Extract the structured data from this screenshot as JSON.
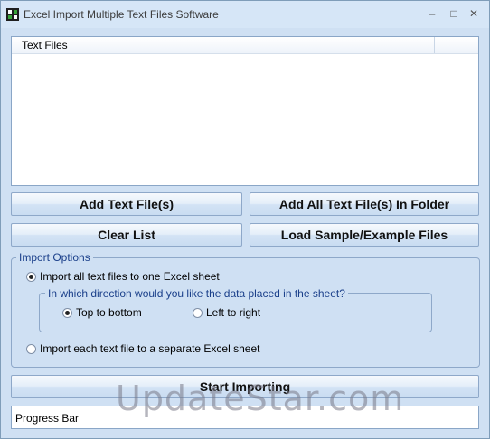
{
  "window": {
    "title": "Excel Import Multiple Text Files Software",
    "controls": {
      "minimize": "–",
      "maximize": "□",
      "close": "✕"
    }
  },
  "list": {
    "column_header": "Text Files",
    "items": []
  },
  "buttons": {
    "add_files": "Add Text File(s)",
    "add_folder": "Add All Text File(s) In Folder",
    "clear": "Clear List",
    "load_sample": "Load Sample/Example Files",
    "start": "Start Importing"
  },
  "import_options": {
    "legend": "Import Options",
    "one_sheet": "Import all text files to one Excel sheet",
    "direction": {
      "legend": "In which direction would you like the data placed in the sheet?",
      "top_to_bottom": "Top to bottom",
      "left_to_right": "Left to right"
    },
    "separate_sheet": "Import each text file to a separate Excel sheet"
  },
  "progress": {
    "label": "Progress Bar"
  },
  "watermark": "UpdateStar.com",
  "colors": {
    "accent": "#1a3f8a",
    "window_bg": "#cfe0f3"
  }
}
